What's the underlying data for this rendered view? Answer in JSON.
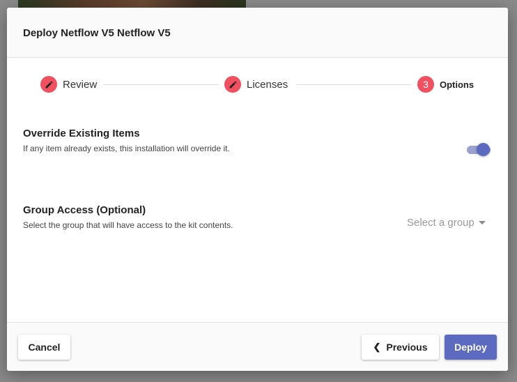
{
  "dialog": {
    "title": "Deploy Netflow V5 Netflow V5"
  },
  "stepper": {
    "steps": [
      {
        "label": "Review",
        "state": "edit",
        "icon": "pencil-icon"
      },
      {
        "label": "Licenses",
        "state": "edit",
        "icon": "pencil-icon"
      },
      {
        "label": "Options",
        "state": "active",
        "number": "3"
      }
    ],
    "accent_color": "#f05060"
  },
  "override": {
    "title": "Override Existing Items",
    "description": "If any item already exists, this installation will override it.",
    "enabled": true
  },
  "group_access": {
    "title": "Group Access (Optional)",
    "description": "Select the group that will have access to the kit contents.",
    "placeholder": "Select a group"
  },
  "footer": {
    "cancel_label": "Cancel",
    "previous_label": "Previous",
    "deploy_label": "Deploy",
    "primary_color": "#5c6bc0"
  }
}
